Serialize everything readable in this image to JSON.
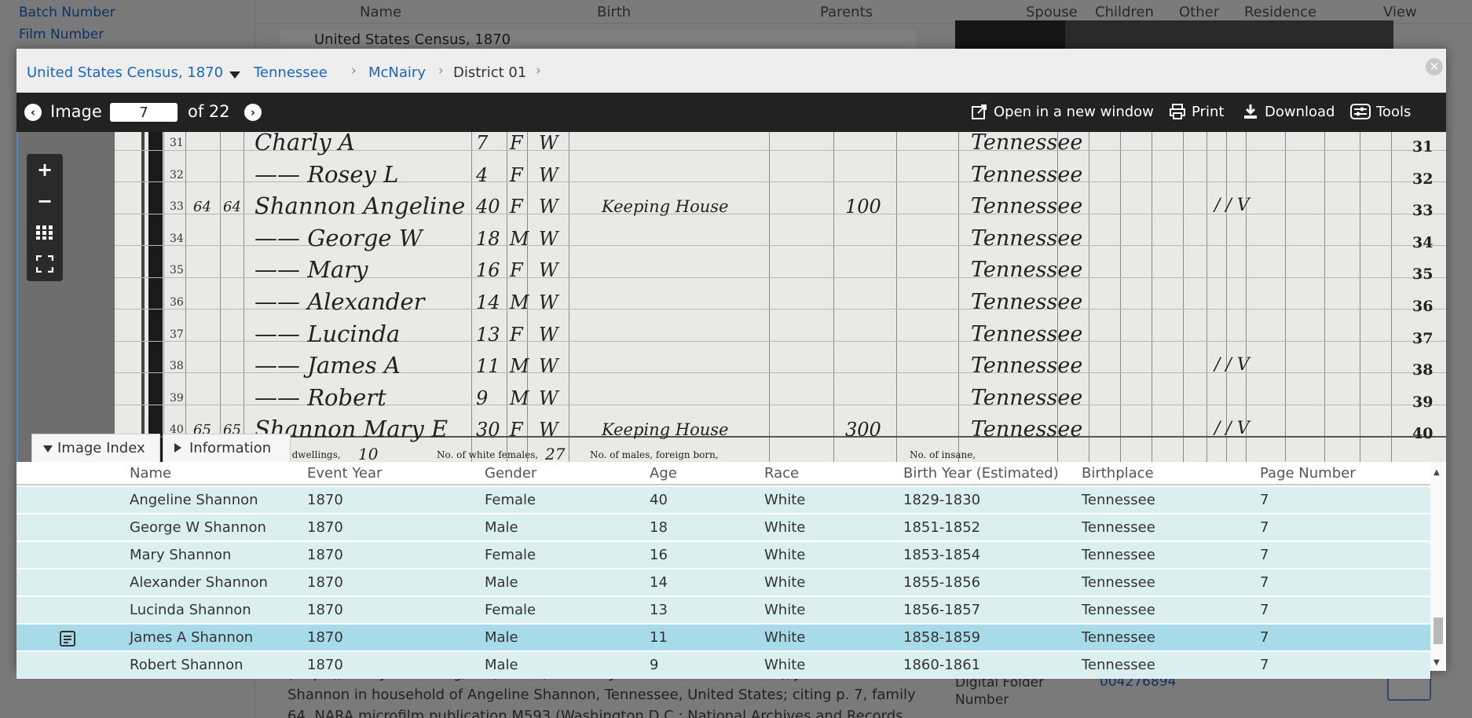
{
  "background": {
    "left_links": [
      "Batch Number",
      "Film Number"
    ],
    "header_cols": [
      "Name",
      "Birth",
      "Parents",
      "Spouse",
      "Children",
      "Other",
      "Residence",
      "View"
    ],
    "row_text": "United States Census, 1870",
    "citation": "(https://familysearch.org/ark:/61903/1:1:MDDJ-6HT : 17 October 2014), James A Shannon in household of Angeline Shannon, Tennessee, United States; citing p. 7, family 64, NARA microfilm publication M593 (Washington D.C.: National Archives and Records",
    "folder_label": "Digital Folder Number",
    "folder_value": "004276894"
  },
  "breadcrumb": {
    "collection": "United States Census, 1870",
    "state": "Tennessee",
    "county": "McNairy",
    "district": "District 01"
  },
  "toolbar": {
    "image_label": "Image",
    "image_value": "7",
    "of_label": "of 22",
    "open_new": "Open in a new window",
    "print": "Print",
    "download": "Download",
    "tools": "Tools"
  },
  "census_image": {
    "line_numbers": [
      "31",
      "32",
      "33",
      "34",
      "35",
      "36",
      "37",
      "38",
      "39",
      "40"
    ],
    "small_line_numbers": [
      "31",
      "32",
      "33",
      "34",
      "35",
      "36",
      "37",
      "38",
      "39",
      "40"
    ],
    "rows": [
      {
        "dw": "",
        "fam": "",
        "name": "Charly A",
        "age": "7",
        "sex": "F",
        "race": "W",
        "occ": "",
        "val": "",
        "place": "Tennessee",
        "marks": ""
      },
      {
        "dw": "",
        "fam": "",
        "name": "—— Rosey L",
        "age": "4",
        "sex": "F",
        "race": "W",
        "occ": "",
        "val": "",
        "place": "Tennessee",
        "marks": ""
      },
      {
        "dw": "64",
        "fam": "64",
        "name": "Shannon Angeline",
        "age": "40",
        "sex": "F",
        "race": "W",
        "occ": "Keeping House",
        "val": "100",
        "place": "Tennessee",
        "marks": "/ / V"
      },
      {
        "dw": "",
        "fam": "",
        "name": "—— George W",
        "age": "18",
        "sex": "M",
        "race": "W",
        "occ": "",
        "val": "",
        "place": "Tennessee",
        "marks": ""
      },
      {
        "dw": "",
        "fam": "",
        "name": "—— Mary",
        "age": "16",
        "sex": "F",
        "race": "W",
        "occ": "",
        "val": "",
        "place": "Tennessee",
        "marks": ""
      },
      {
        "dw": "",
        "fam": "",
        "name": "—— Alexander",
        "age": "14",
        "sex": "M",
        "race": "W",
        "occ": "",
        "val": "",
        "place": "Tennessee",
        "marks": ""
      },
      {
        "dw": "",
        "fam": "",
        "name": "—— Lucinda",
        "age": "13",
        "sex": "F",
        "race": "W",
        "occ": "",
        "val": "",
        "place": "Tennessee",
        "marks": ""
      },
      {
        "dw": "",
        "fam": "",
        "name": "—— James A",
        "age": "11",
        "sex": "M",
        "race": "W",
        "occ": "",
        "val": "",
        "place": "Tennessee",
        "marks": "/ / V"
      },
      {
        "dw": "",
        "fam": "",
        "name": "—— Robert",
        "age": "9",
        "sex": "M",
        "race": "W",
        "occ": "",
        "val": "",
        "place": "Tennessee",
        "marks": ""
      },
      {
        "dw": "65",
        "fam": "65",
        "name": "Shannon Mary E",
        "age": "30",
        "sex": "F",
        "race": "W",
        "occ": "Keeping House",
        "val": "300",
        "place": "Tennessee",
        "marks": "/ / V"
      }
    ],
    "footer": {
      "dwellings": "No. of dwellings,",
      "dwellings_val": "10",
      "white_females": "No. of white females,",
      "white_females_val": "27",
      "foreign_males": "No. of males, foreign born,",
      "insane": "No. of insane,"
    }
  },
  "tabs": {
    "image_index": "Image Index",
    "information": "Information"
  },
  "table": {
    "columns": [
      "Name",
      "Event Year",
      "Gender",
      "Age",
      "Race",
      "Birth Year (Estimated)",
      "Birthplace",
      "Page Number"
    ],
    "rows": [
      [
        "Angeline Shannon",
        "1870",
        "Female",
        "40",
        "White",
        "1829-1830",
        "Tennessee",
        "7"
      ],
      [
        "George W Shannon",
        "1870",
        "Male",
        "18",
        "White",
        "1851-1852",
        "Tennessee",
        "7"
      ],
      [
        "Mary Shannon",
        "1870",
        "Female",
        "16",
        "White",
        "1853-1854",
        "Tennessee",
        "7"
      ],
      [
        "Alexander Shannon",
        "1870",
        "Male",
        "14",
        "White",
        "1855-1856",
        "Tennessee",
        "7"
      ],
      [
        "Lucinda Shannon",
        "1870",
        "Female",
        "13",
        "White",
        "1856-1857",
        "Tennessee",
        "7"
      ],
      [
        "James A Shannon",
        "1870",
        "Male",
        "11",
        "White",
        "1858-1859",
        "Tennessee",
        "7"
      ],
      [
        "Robert Shannon",
        "1870",
        "Male",
        "9",
        "White",
        "1860-1861",
        "Tennessee",
        "7"
      ]
    ],
    "selected_row": 5
  },
  "colors": {
    "link": "#1a66c2",
    "toolbar_bg": "#222222",
    "row_bg": "#dbeef0",
    "row_selected": "#a8dbe9"
  }
}
